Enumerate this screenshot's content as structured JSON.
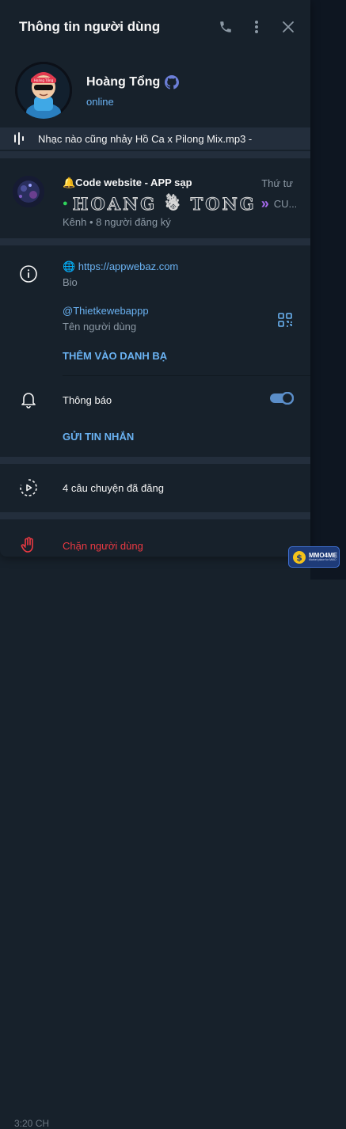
{
  "header": {
    "title": "Thông tin người dùng",
    "call_icon": "phone-icon",
    "more_icon": "more-vertical-icon",
    "close_icon": "close-icon"
  },
  "profile": {
    "name": "Hoàng Tổng",
    "status": "online",
    "badge_icon": "github-icon"
  },
  "music": {
    "track": "Nhạc nào cũng nhảy Hồ Ca x Pilong Mix.mp3 -"
  },
  "channel": {
    "title": "🔔Code website - APP sạp",
    "day": "Thứ tư",
    "preview_bullet": "●",
    "preview_name": "HOANG ☃ TONG",
    "preview_more": "»",
    "preview_tail": "CU...",
    "subtitle": "Kênh • 8 người đăng ký"
  },
  "info": {
    "bio_value": "🌐 https://appwebaz.com",
    "bio_label": "Bio",
    "username_value": "@Thietkewebappp",
    "username_label": "Tên người dùng",
    "add_contact": "THÊM VÀO DANH BẠ",
    "notifications_label": "Thông báo",
    "notifications_on": true,
    "send_message": "GỬI TIN NHẮN"
  },
  "stories": {
    "label": "4 câu chuyện đã đăng"
  },
  "block": {
    "label": "Chặn người dùng"
  },
  "background": {
    "top_text": "online",
    "bottom_text": "3:20 CH"
  },
  "watermark": {
    "text": "MMO4ME",
    "subtext": "Market place for MMO"
  },
  "colors": {
    "accent": "#6ab2f2",
    "danger": "#ec3942",
    "panel": "#17212b",
    "separator": "#232e3c"
  }
}
